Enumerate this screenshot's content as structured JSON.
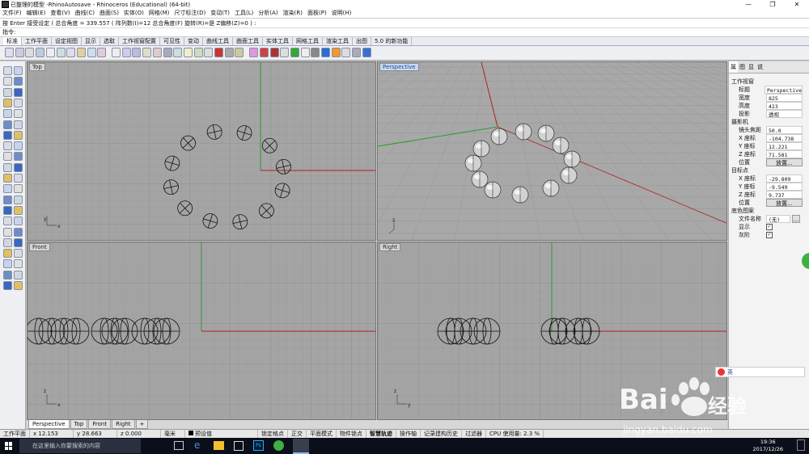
{
  "window": {
    "title": "已整理的模型 -RhinoAutosave - Rhinoceros (Educational) (64-bit)",
    "minimize": "—",
    "restore": "❐",
    "close": "✕"
  },
  "menu": [
    "文件(F)",
    "编辑(E)",
    "查看(V)",
    "曲线(C)",
    "曲面(S)",
    "实体(O)",
    "网格(M)",
    "尺寸标注(D)",
    "变动(T)",
    "工具(L)",
    "分析(A)",
    "渲染(R)",
    "面板(P)",
    "说明(H)"
  ],
  "command_history": "按 Enter 接受设定 ( 总合角度 = 339.557 ( 阵列数(I)=12  总合角度(F)  旋转(R)=是  Z偏移(Z)=0 ) :",
  "command_prompt": "指令:",
  "toolbar_tabs": {
    "items": [
      "标准",
      "工作平面",
      "设定视图",
      "显示",
      "选取",
      "工作视窗配置",
      "可见性",
      "变动",
      "曲线工具",
      "曲面工具",
      "实体工具",
      "网格工具",
      "渲染工具",
      "出图",
      "5.0 的新功能"
    ],
    "active": "标准"
  },
  "viewports": {
    "top": {
      "label": "Top"
    },
    "perspective": {
      "label": "Perspective"
    },
    "front": {
      "label": "Front"
    },
    "right": {
      "label": "Right"
    }
  },
  "viewport_tabs": [
    "Perspective",
    "Top",
    "Front",
    "Right"
  ],
  "viewport_tab_add": "+",
  "panel": {
    "tabs": [
      "属",
      "图",
      "显",
      "说"
    ],
    "view_section": "工作视窗",
    "title_label": "标题",
    "title_value": "Perspective",
    "width_label": "宽度",
    "width_value": "825",
    "height_label": "高度",
    "height_value": "423",
    "projection_label": "投影",
    "projection_value": "透视",
    "camera_section": "摄影机",
    "lens_label": "镜头焦距",
    "lens_value": "50.0",
    "cx_label": "X 座标",
    "cx_value": "-104.738",
    "cy_label": "Y 座标",
    "cy_value": "12.221",
    "cz_label": "Z 座标",
    "cz_value": "71.581",
    "cpos_label": "位置",
    "cpos_btn": "放置...",
    "target_section": "目标点",
    "tx_label": "X 座标",
    "tx_value": "-29.809",
    "ty_label": "Y 座标",
    "ty_value": "-9.549",
    "tz_label": "Z 座标",
    "tz_value": "9.737",
    "tpos_label": "位置",
    "tpos_btn": "放置...",
    "bg_section": "底色图案",
    "file_label": "文件名称",
    "file_value": "(无)",
    "file_btn": "...",
    "show_label": "显示",
    "gray_label": "灰阶"
  },
  "status": {
    "cplane": "工作平面",
    "x": "x 12.153",
    "y": "y 28.663",
    "z": "z 0.000",
    "unit": "毫米",
    "layer": "预设值",
    "items": [
      "锁定格点",
      "正交",
      "平面模式",
      "物件锁点",
      "智慧轨迹",
      "操作轴",
      "记录建构历史",
      "过滤器",
      "CPU 使用量: 2.3 %"
    ]
  },
  "taskbar": {
    "search_placeholder": "在这里输入你要搜索的内容",
    "time": "19:36",
    "date": "2017/12/26"
  },
  "watermark": {
    "brand": "Bai",
    "brand2": "经验",
    "url": "jingyan.baidu.com"
  },
  "ime_bar": "英"
}
